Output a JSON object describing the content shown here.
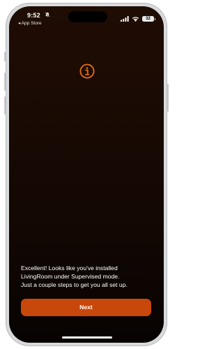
{
  "status_bar": {
    "time": "9:52",
    "back_label": "◂ App Store",
    "battery": "32",
    "icons": [
      "bell-slash-icon",
      "signal-icon",
      "wifi-icon",
      "battery-icon"
    ]
  },
  "main": {
    "icon": "info-circle-icon",
    "message_lines": [
      "Excellent! Looks like you've installed",
      "LivingRoom under Supervised mode.",
      "Just a couple steps to get you all set up."
    ],
    "next_label": "Next"
  },
  "colors": {
    "accent": "#c8470a",
    "icon_orange": "#e9700f",
    "background_top": "#1f0d04",
    "background_bottom": "#070302"
  }
}
